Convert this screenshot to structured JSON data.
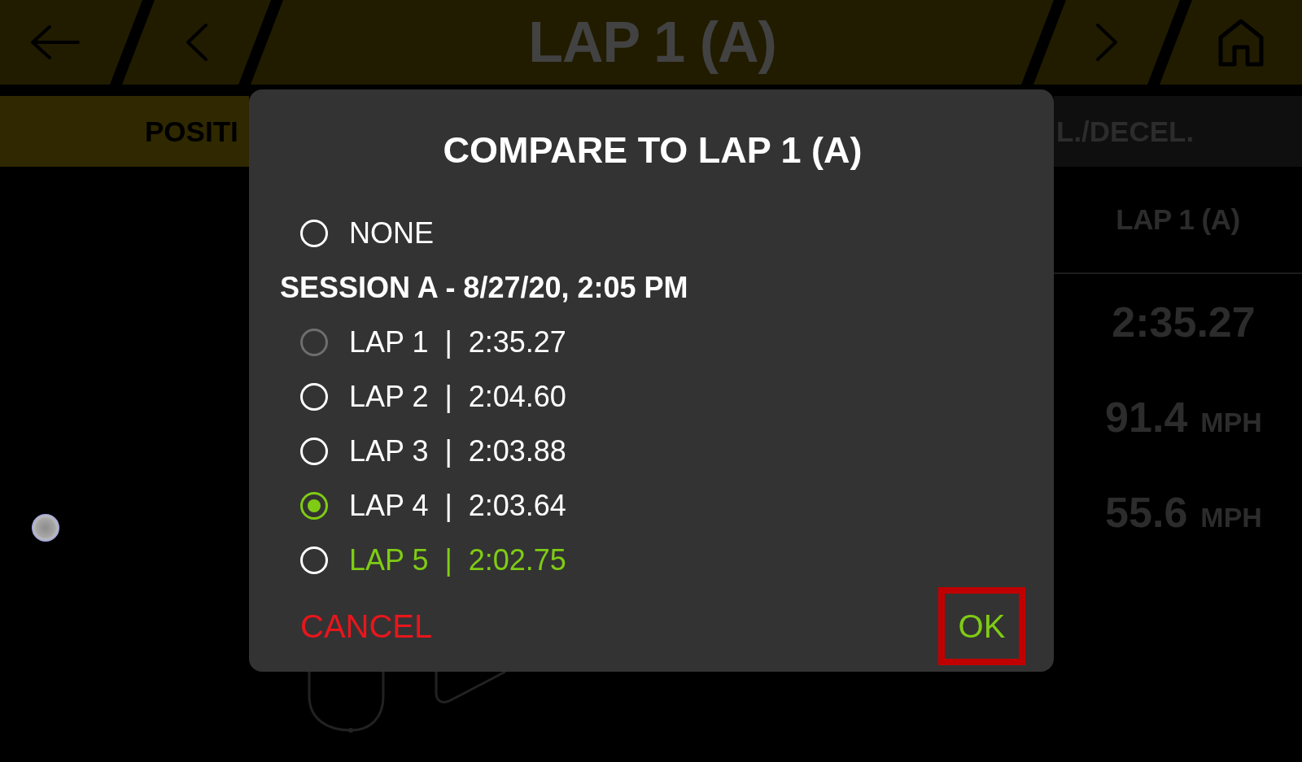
{
  "top_bar": {
    "title": "LAP 1 (A)"
  },
  "tabs": [
    {
      "label": "POSITI",
      "selected": true
    },
    {
      "label": "L./DECEL.",
      "selected": false
    }
  ],
  "compare_table": {
    "header": "LAP 1 (A)",
    "rows": [
      {
        "value": "2:35.27"
      },
      {
        "value": "91.4",
        "unit": "MPH"
      },
      {
        "value": "55.6",
        "unit": "MPH"
      }
    ]
  },
  "dialog": {
    "title": "COMPARE TO LAP 1 (A)",
    "items": [
      {
        "kind": "option",
        "label": "NONE",
        "selected": false,
        "disabled": false,
        "best": false
      },
      {
        "kind": "header",
        "label": "SESSION A - 8/27/20, 2:05 PM"
      },
      {
        "kind": "option",
        "label": "LAP 1  |  2:35.27",
        "selected": false,
        "disabled": true,
        "best": false
      },
      {
        "kind": "option",
        "label": "LAP 2  |  2:04.60",
        "selected": false,
        "disabled": false,
        "best": false
      },
      {
        "kind": "option",
        "label": "LAP 3  |  2:03.88",
        "selected": false,
        "disabled": false,
        "best": false
      },
      {
        "kind": "option",
        "label": "LAP 4  |  2:03.64",
        "selected": true,
        "disabled": false,
        "best": false
      },
      {
        "kind": "option",
        "label": "LAP 5  |  2:02.75",
        "selected": false,
        "disabled": false,
        "best": true
      }
    ],
    "buttons": [
      {
        "kind": "cancel",
        "label": "CANCEL",
        "highlighted": false
      },
      {
        "kind": "confirm",
        "label": "OK",
        "highlighted": true
      }
    ]
  }
}
